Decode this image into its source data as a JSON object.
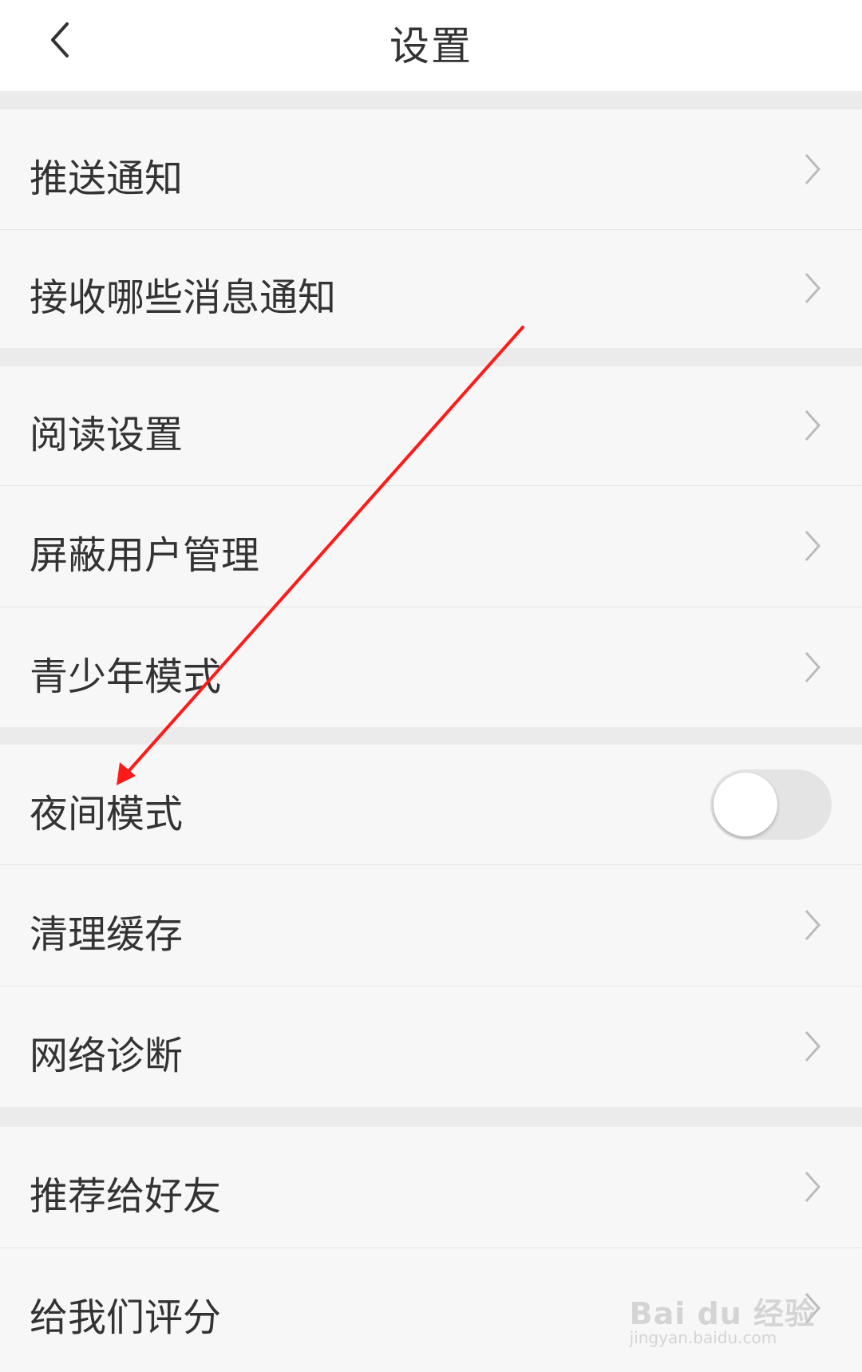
{
  "header": {
    "title": "设置"
  },
  "settings": {
    "items": [
      {
        "label": "推送通知"
      },
      {
        "label": "接收哪些消息通知"
      },
      {
        "label": "阅读设置"
      },
      {
        "label": "屏蔽用户管理"
      },
      {
        "label": "青少年模式"
      },
      {
        "label": "夜间模式",
        "toggle": false
      },
      {
        "label": "清理缓存"
      },
      {
        "label": "网络诊断"
      },
      {
        "label": "推荐给好友"
      },
      {
        "label": "给我们评分"
      }
    ]
  },
  "icons": {
    "back": "chevron-left-icon",
    "row_arrow": "chevron-right-icon"
  },
  "colors": {
    "background": "#ebebeb",
    "row_background": "#f7f7f7",
    "header_background": "#ffffff",
    "text": "#333333",
    "chevron": "#bbbbbb",
    "toggle_off": "#e4e4e4",
    "annotation_arrow": "#ff1a1a"
  },
  "watermark": {
    "logo": "Bai du 经验",
    "url": "jingyan.baidu.com"
  }
}
